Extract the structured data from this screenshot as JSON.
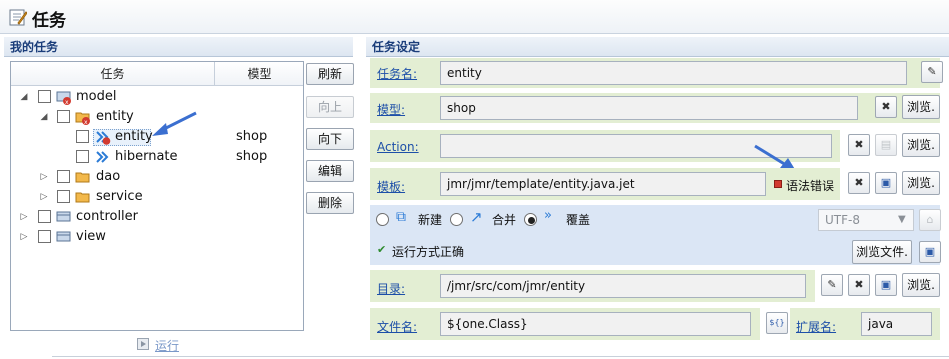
{
  "window": {
    "title": "任务"
  },
  "left_panel": {
    "header": "我的任务",
    "columns": {
      "task": "任务",
      "model": "模型"
    },
    "tree": [
      {
        "label": "model",
        "model": "",
        "expanded": true
      },
      {
        "label": "entity",
        "model": "",
        "expanded": true
      },
      {
        "label": "entity",
        "model": "shop",
        "selected": true
      },
      {
        "label": "hibernate",
        "model": "shop"
      },
      {
        "label": "dao",
        "model": "",
        "expanded": false
      },
      {
        "label": "service",
        "model": "",
        "expanded": false
      },
      {
        "label": "controller",
        "model": "",
        "expanded": false
      },
      {
        "label": "view",
        "model": "",
        "expanded": false
      }
    ],
    "buttons": {
      "refresh": "刷新",
      "up": "向上",
      "down": "向下",
      "edit": "编辑",
      "delete": "删除"
    },
    "run_label": "运行"
  },
  "right_panel": {
    "header": "任务设定",
    "task_name": {
      "label": "任务名:",
      "value": "entity"
    },
    "model": {
      "label": "模型:",
      "value": "shop",
      "browse": "浏览."
    },
    "action": {
      "label": "Action:",
      "value": "",
      "browse": "浏览."
    },
    "template": {
      "label": "模板:",
      "value": "jmr/jmr/template/entity.java.jet",
      "error": "语法错误",
      "browse": "浏览."
    },
    "mode": {
      "options": [
        {
          "label": "新建",
          "checked": false
        },
        {
          "label": "合并",
          "checked": false
        },
        {
          "label": "覆盖",
          "checked": true
        }
      ],
      "encoding": "UTF-8",
      "run_status": "运行方式正确",
      "browse_file": "浏览文件."
    },
    "directory": {
      "label": "目录:",
      "value": "/jmr/src/com/jmr/entity",
      "browse": "浏览."
    },
    "file_name": {
      "label": "文件名:",
      "value": "${one.Class}",
      "expr_icon": "${}"
    },
    "extension": {
      "label": "扩展名:",
      "value": "java"
    }
  },
  "colors": {
    "accent": "#1d4fa8",
    "band": "#e3eed3",
    "annotation_arrow": "#3b6fd0",
    "error": "#d23a2f"
  }
}
